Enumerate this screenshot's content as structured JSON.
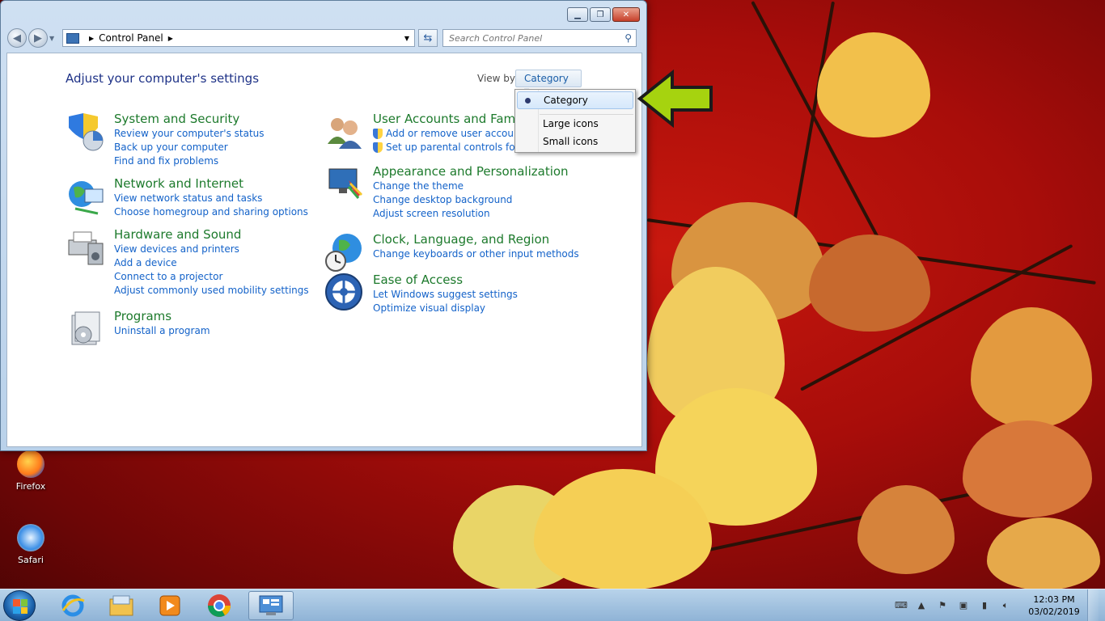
{
  "window": {
    "breadcrumb": "Control Panel",
    "search_placeholder": "Search Control Panel",
    "page_title": "Adjust your computer's settings",
    "view_by_label": "View by:",
    "view_by_value": "Category"
  },
  "categories": {
    "system": {
      "title": "System and Security",
      "links": [
        "Review your computer's status",
        "Back up your computer",
        "Find and fix problems"
      ]
    },
    "network": {
      "title": "Network and Internet",
      "links": [
        "View network status and tasks",
        "Choose homegroup and sharing options"
      ]
    },
    "hardware": {
      "title": "Hardware and Sound",
      "links": [
        "View devices and printers",
        "Add a device",
        "Connect to a projector",
        "Adjust commonly used mobility settings"
      ]
    },
    "programs": {
      "title": "Programs",
      "links": [
        "Uninstall a program"
      ]
    },
    "users": {
      "title": "User Accounts and Family",
      "links": [
        "Add or remove user accounts",
        "Set up parental controls for an"
      ]
    },
    "appearance": {
      "title": "Appearance and Personalization",
      "links": [
        "Change the theme",
        "Change desktop background",
        "Adjust screen resolution"
      ]
    },
    "clock": {
      "title": "Clock, Language, and Region",
      "links": [
        "Change keyboards or other input methods"
      ]
    },
    "ease": {
      "title": "Ease of Access",
      "links": [
        "Let Windows suggest settings",
        "Optimize visual display"
      ]
    }
  },
  "dropdown": {
    "items": [
      "Category",
      "Large icons",
      "Small icons"
    ],
    "selected": "Category"
  },
  "desktop": {
    "icons": [
      "Firefox",
      "Safari"
    ]
  },
  "taskbar": {
    "time": "12:03 PM",
    "date": "03/02/2019"
  },
  "colors": {
    "category_title": "#1d7a2c",
    "link": "#1362c9",
    "arrow": "#a6d30f"
  }
}
